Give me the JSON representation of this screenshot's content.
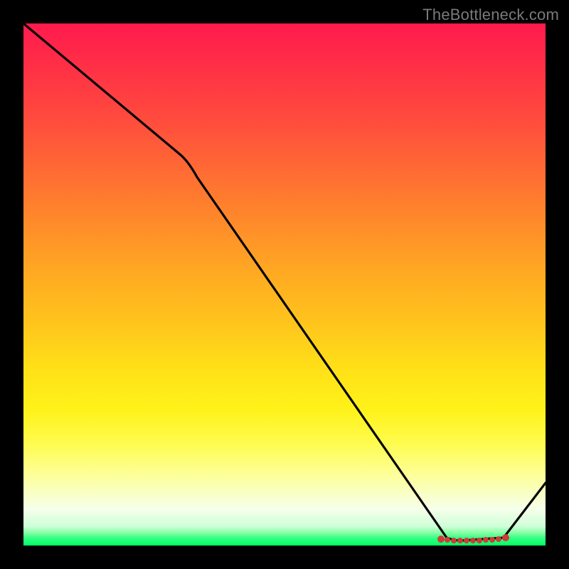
{
  "watermark": {
    "text": "TheBottleneck.com"
  },
  "chart_data": {
    "type": "line",
    "title": "",
    "xlabel": "",
    "ylabel": "",
    "xlim": [
      0,
      100
    ],
    "ylim": [
      0,
      100
    ],
    "series": [
      {
        "name": "curve",
        "x": [
          0,
          30,
          81,
          84,
          92,
          100
        ],
        "values": [
          100,
          75,
          1.5,
          1.0,
          1.5,
          12
        ]
      }
    ],
    "markers": {
      "name": "bottom-dots",
      "x": [
        80,
        81,
        82,
        83,
        84,
        85,
        86,
        87,
        88,
        89,
        90,
        91,
        92
      ],
      "values": [
        1.5,
        1.5,
        1.4,
        1.3,
        1.0,
        1.0,
        1.0,
        1.0,
        1.0,
        1.1,
        1.2,
        1.3,
        1.5
      ],
      "color": "#d23a3a"
    },
    "gradient_stops": [
      {
        "pos": 0,
        "color": "#ff1a4d"
      },
      {
        "pos": 50,
        "color": "#ffaa22"
      },
      {
        "pos": 80,
        "color": "#fffb4a"
      },
      {
        "pos": 100,
        "color": "#00ff66"
      }
    ]
  }
}
